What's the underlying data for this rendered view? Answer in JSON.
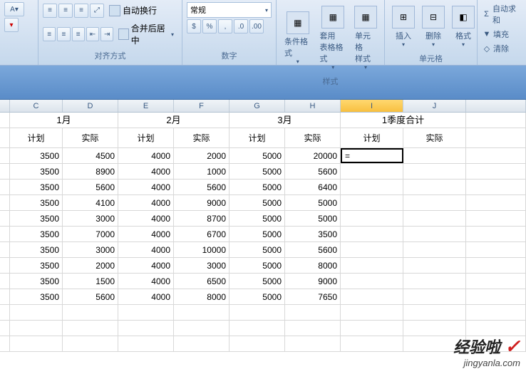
{
  "ribbon": {
    "font": {
      "letter": "A"
    },
    "alignment": {
      "title": "对齐方式",
      "wrap_label": "自动换行",
      "merge_label": "合并后居中"
    },
    "number": {
      "title": "数字",
      "format_selected": "常规"
    },
    "styles": {
      "title": "样式",
      "conditional": "条件格式",
      "table_format": "套用\n表格格式",
      "cell_styles": "单元格\n样式"
    },
    "cells": {
      "title": "单元格",
      "insert": "插入",
      "delete": "删除",
      "format": "格式"
    },
    "editing": {
      "autosum": "自动求和",
      "fill": "填充",
      "clear": "清除"
    }
  },
  "columns": [
    "",
    "C",
    "D",
    "E",
    "F",
    "G",
    "H",
    "I",
    "J",
    ""
  ],
  "merged_headers": {
    "m1": "1月",
    "m2": "2月",
    "m3": "3月",
    "q1": "1季度合计"
  },
  "sub_headers": {
    "plan": "计划",
    "actual": "实际"
  },
  "editing_cell": "=",
  "grid": [
    [
      3500,
      4500,
      4000,
      2000,
      5000,
      20000
    ],
    [
      3500,
      8900,
      4000,
      1000,
      5000,
      5600
    ],
    [
      3500,
      5600,
      4000,
      5600,
      5000,
      6400
    ],
    [
      3500,
      4100,
      4000,
      9000,
      5000,
      5000
    ],
    [
      3500,
      3000,
      4000,
      8700,
      5000,
      5000
    ],
    [
      3500,
      7000,
      4000,
      6700,
      5000,
      3500
    ],
    [
      3500,
      3000,
      4000,
      10000,
      5000,
      5600
    ],
    [
      3500,
      2000,
      4000,
      3000,
      5000,
      8000
    ],
    [
      3500,
      1500,
      4000,
      6500,
      5000,
      9000
    ],
    [
      3500,
      5600,
      4000,
      8000,
      5000,
      7650
    ]
  ],
  "watermark": {
    "main": "经验啦",
    "sub": "jingyanla.com"
  }
}
